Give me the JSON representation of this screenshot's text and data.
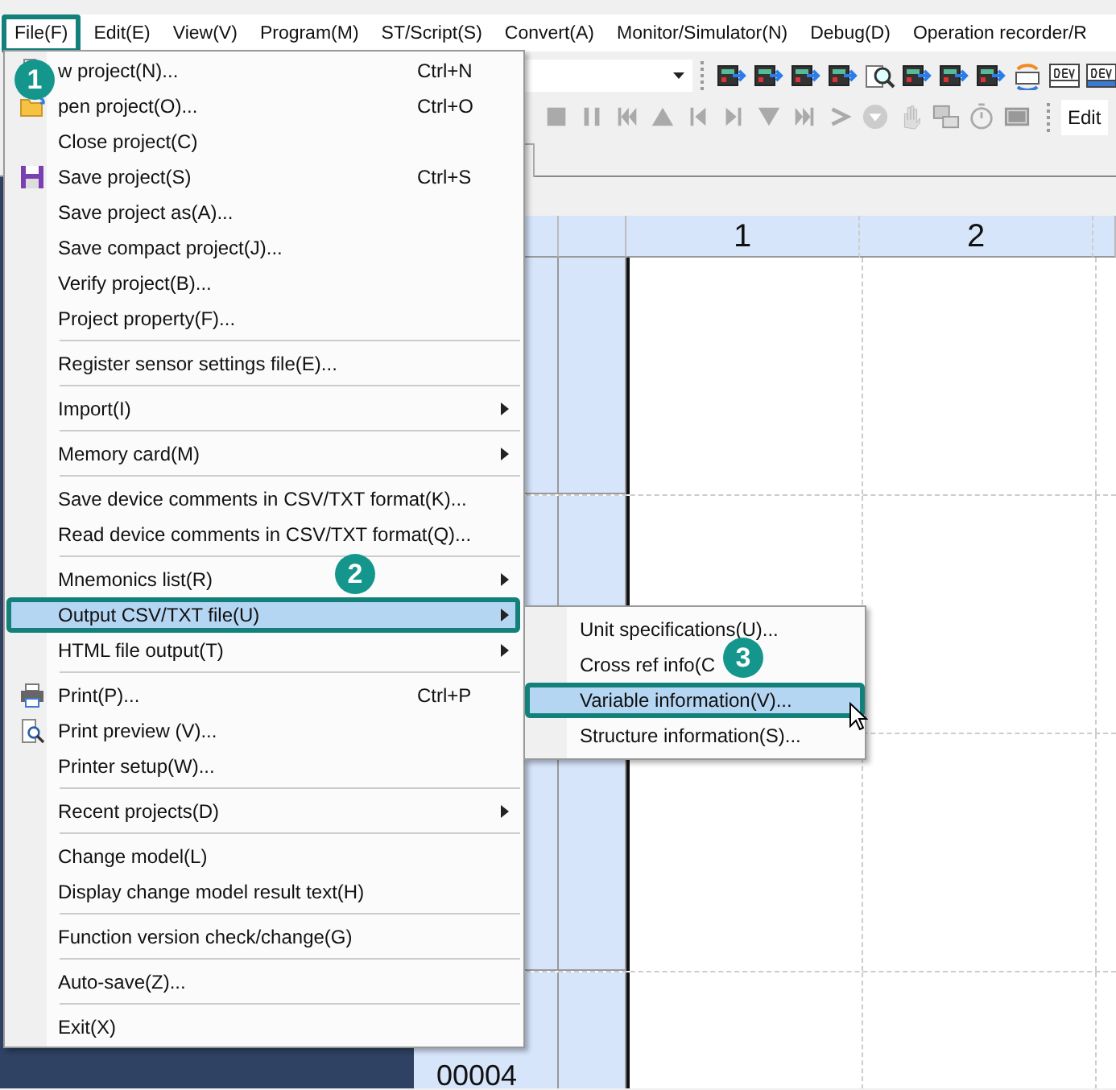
{
  "menu_bar": {
    "items": [
      {
        "label": "File(F)",
        "selected": true
      },
      {
        "label": "Edit(E)",
        "selected": false
      },
      {
        "label": "View(V)",
        "selected": false
      },
      {
        "label": "Program(M)",
        "selected": false
      },
      {
        "label": "ST/Script(S)",
        "selected": false
      },
      {
        "label": "Convert(A)",
        "selected": false
      },
      {
        "label": "Monitor/Simulator(N)",
        "selected": false
      },
      {
        "label": "Debug(D)",
        "selected": false
      },
      {
        "label": "Operation recorder/R",
        "selected": false
      }
    ]
  },
  "toolbar": {
    "mode_field": {
      "value": "Edit"
    }
  },
  "ladder": {
    "columns": [
      "1",
      "2"
    ],
    "row_label": "00004"
  },
  "file_menu": {
    "groups": [
      [
        {
          "label": "w project(N)...",
          "shortcut": "Ctrl+N",
          "submenu": false,
          "selected": false
        },
        {
          "label": "pen project(O)...",
          "shortcut": "Ctrl+O",
          "submenu": false,
          "selected": false
        },
        {
          "label": "Close project(C)",
          "submenu": false,
          "selected": false
        },
        {
          "label": "Save project(S)",
          "shortcut": "Ctrl+S",
          "submenu": false,
          "selected": false
        },
        {
          "label": "Save project as(A)...",
          "submenu": false,
          "selected": false
        },
        {
          "label": "Save compact project(J)...",
          "submenu": false,
          "selected": false
        },
        {
          "label": "Verify project(B)...",
          "submenu": false,
          "selected": false
        },
        {
          "label": "Project property(F)...",
          "submenu": false,
          "selected": false
        }
      ],
      [
        {
          "label": "Register sensor settings file(E)...",
          "submenu": false,
          "selected": false
        }
      ],
      [
        {
          "label": "Import(I)",
          "submenu": true,
          "selected": false
        }
      ],
      [
        {
          "label": "Memory card(M)",
          "submenu": true,
          "selected": false
        }
      ],
      [
        {
          "label": "Save device comments in CSV/TXT format(K)...",
          "submenu": false,
          "selected": false
        },
        {
          "label": "Read device comments in CSV/TXT format(Q)...",
          "submenu": false,
          "selected": false
        }
      ],
      [
        {
          "label": "Mnemonics list(R)",
          "submenu": true,
          "selected": false
        },
        {
          "label": "Output CSV/TXT file(U)",
          "submenu": true,
          "selected": true
        },
        {
          "label": "HTML file output(T)",
          "submenu": true,
          "selected": false
        }
      ],
      [
        {
          "label": "Print(P)...",
          "shortcut": "Ctrl+P",
          "submenu": false,
          "selected": false
        },
        {
          "label": "Print preview (V)...",
          "submenu": false,
          "selected": false
        },
        {
          "label": "Printer setup(W)...",
          "submenu": false,
          "selected": false
        }
      ],
      [
        {
          "label": "Recent projects(D)",
          "submenu": true,
          "selected": false
        }
      ],
      [
        {
          "label": "Change model(L)",
          "submenu": false,
          "selected": false
        },
        {
          "label": "Display change model result text(H)",
          "submenu": false,
          "selected": false
        }
      ],
      [
        {
          "label": "Function version check/change(G)",
          "submenu": false,
          "selected": false
        }
      ],
      [
        {
          "label": "Auto-save(Z)...",
          "submenu": false,
          "selected": false
        }
      ],
      [
        {
          "label": "Exit(X)",
          "submenu": false,
          "selected": false
        }
      ]
    ]
  },
  "submenu": {
    "items": [
      {
        "label": "Unit specifications(U)...",
        "selected": false
      },
      {
        "label": "Cross ref info(C",
        "selected": false
      },
      {
        "label": "Variable information(V)...",
        "selected": true
      },
      {
        "label": "Structure information(S)...",
        "selected": false
      }
    ]
  },
  "step_badges": [
    "1",
    "2",
    "3"
  ]
}
